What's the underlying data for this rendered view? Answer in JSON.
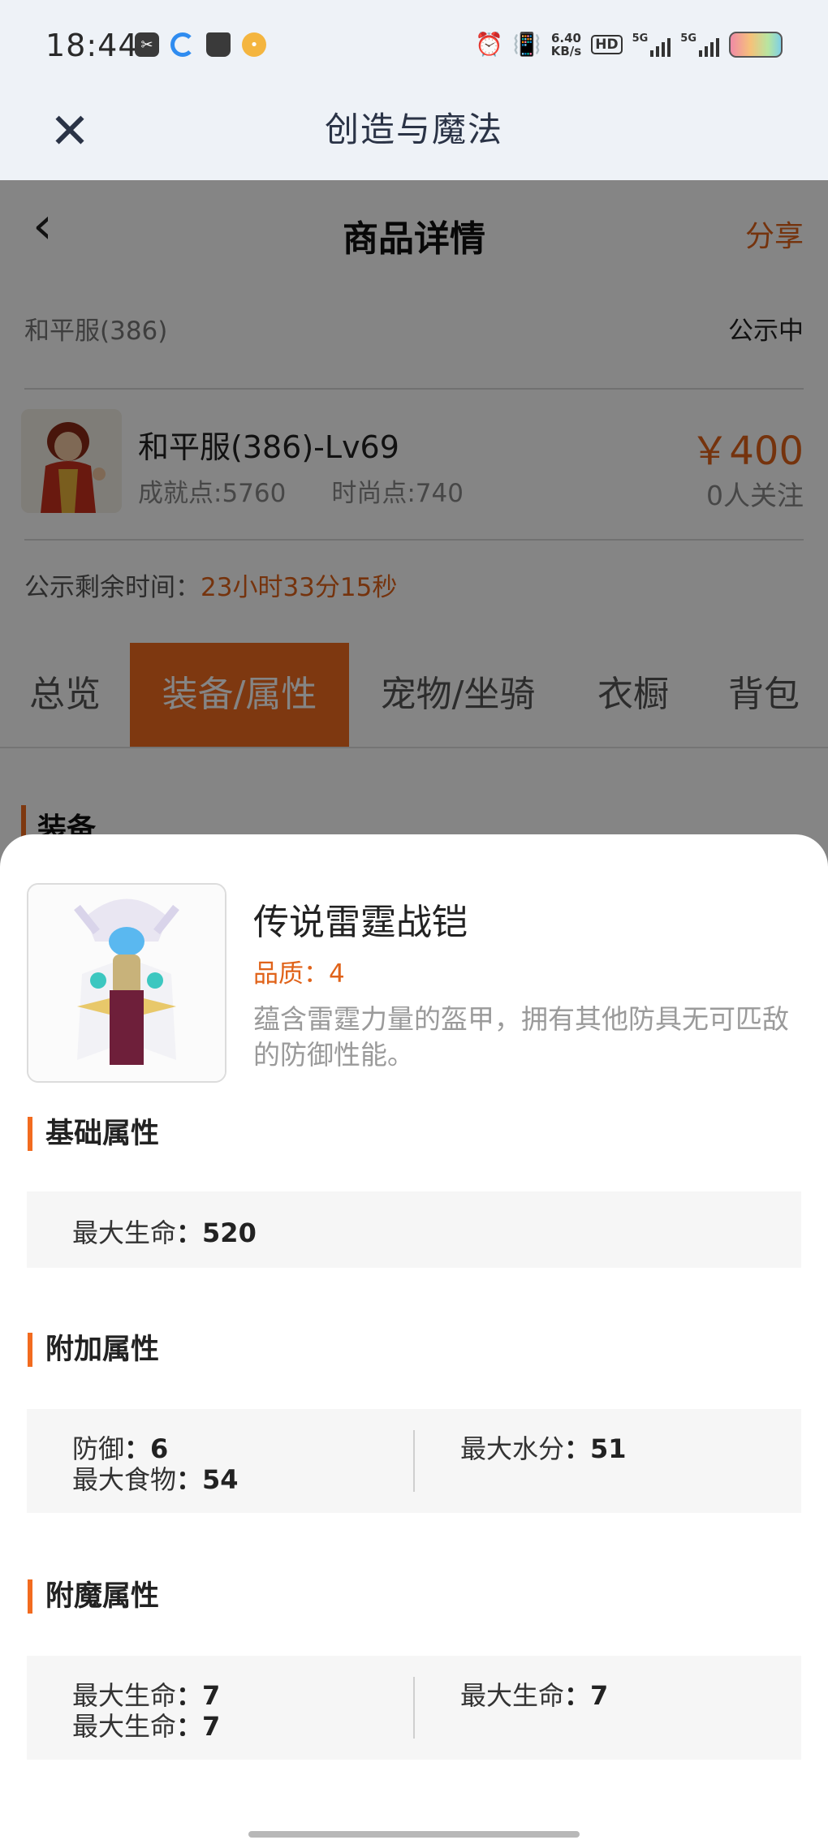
{
  "status_bar": {
    "time": "18:44",
    "net_speed_value": "6.40",
    "net_speed_unit": "KB/s",
    "hd_label": "HD",
    "sim1_label": "5G",
    "sim2_label": "5G",
    "icons": [
      "scissors-app-icon",
      "browser-app-icon",
      "book-app-icon",
      "mascot-app-icon",
      "alarm-icon",
      "vibrate-icon",
      "battery-icon"
    ]
  },
  "titlebar": {
    "title": "创造与魔法",
    "close_icon": "close-icon"
  },
  "page": {
    "header": {
      "title": "商品详情",
      "share": "分享",
      "back_icon": "chevron-left-icon"
    },
    "server": {
      "name": "和平服(386)",
      "status": "公示中"
    },
    "role": {
      "name": "和平服(386)-Lv69",
      "achievement": "成就点:5760",
      "fashion": "时尚点:740",
      "price": "￥400",
      "followers": "0人关注"
    },
    "remaining": {
      "label": "公示剩余时间：",
      "value": "23小时33分15秒"
    },
    "tabs": [
      {
        "label": "总览",
        "active": false
      },
      {
        "label": "装备/属性",
        "active": true
      },
      {
        "label": "宠物/坐骑",
        "active": false
      },
      {
        "label": "衣橱",
        "active": false
      },
      {
        "label": "背包",
        "active": false
      }
    ],
    "section_peek": "装备"
  },
  "sheet": {
    "item": {
      "name": "传说雷霆战铠",
      "quality_label": "品质：",
      "quality_value": "4",
      "description": "蕴含雷霆力量的盔甲，拥有其他防具无可匹敌的防御性能。"
    },
    "basic": {
      "title": "基础属性",
      "rows": [
        {
          "name": "最大生命",
          "sep": "：",
          "value": "520"
        }
      ]
    },
    "extra": {
      "title": "附加属性",
      "left": [
        {
          "name": "防御",
          "sep": "：",
          "value": "6"
        },
        {
          "name": "最大食物",
          "sep": "：",
          "value": "54"
        }
      ],
      "right": [
        {
          "name": "最大水分",
          "sep": "：",
          "value": "51"
        }
      ]
    },
    "enchant": {
      "title": "附魔属性",
      "left": [
        {
          "name": "最大生命",
          "sep": "：",
          "value": "7"
        },
        {
          "name": "最大生命",
          "sep": "：",
          "value": "7"
        }
      ],
      "right": [
        {
          "name": "最大生命",
          "sep": "：",
          "value": "7"
        }
      ]
    }
  },
  "colors": {
    "accent": "#f26b1f",
    "price": "#e0631a",
    "chrome_bg": "#eef2f7"
  }
}
